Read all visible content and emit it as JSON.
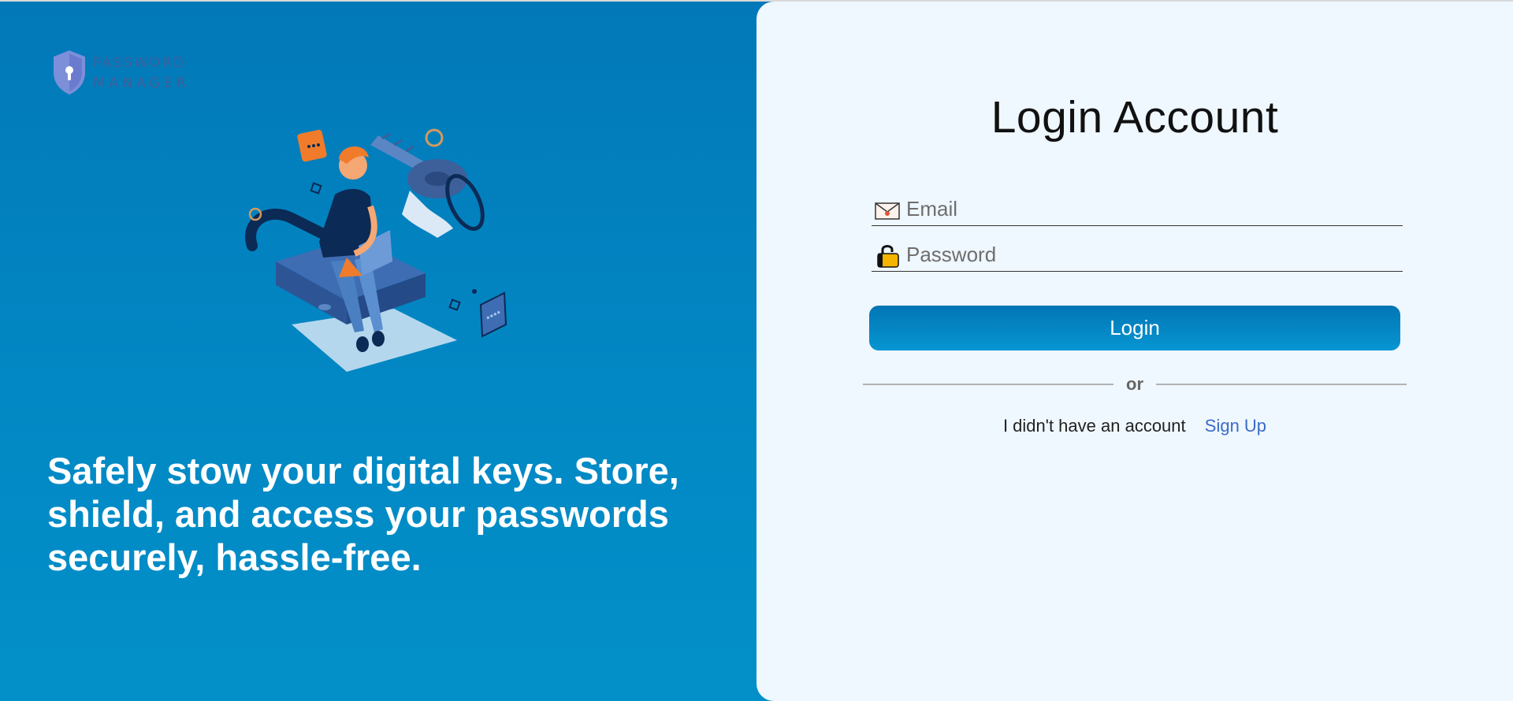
{
  "brand": {
    "line1": "PASSWORD",
    "line2": "MANAGER"
  },
  "hero": {
    "tagline": "Safely stow your digital keys. Store, shield, and access your passwords securely, hassle-free."
  },
  "login": {
    "title": "Login Account",
    "email_placeholder": "Email",
    "password_placeholder": "Password",
    "login_label": "Login",
    "divider_text": "or",
    "signup_prompt": "I didn't have an account",
    "signup_link": "Sign Up"
  },
  "icons": {
    "email": "envelope-icon",
    "password": "lock-icon",
    "logo": "shield-keyhole-icon"
  },
  "colors": {
    "left_panel": "#0283c0",
    "right_panel": "#eff7ff",
    "button": "#0284c4",
    "link": "#3a6bc7"
  }
}
